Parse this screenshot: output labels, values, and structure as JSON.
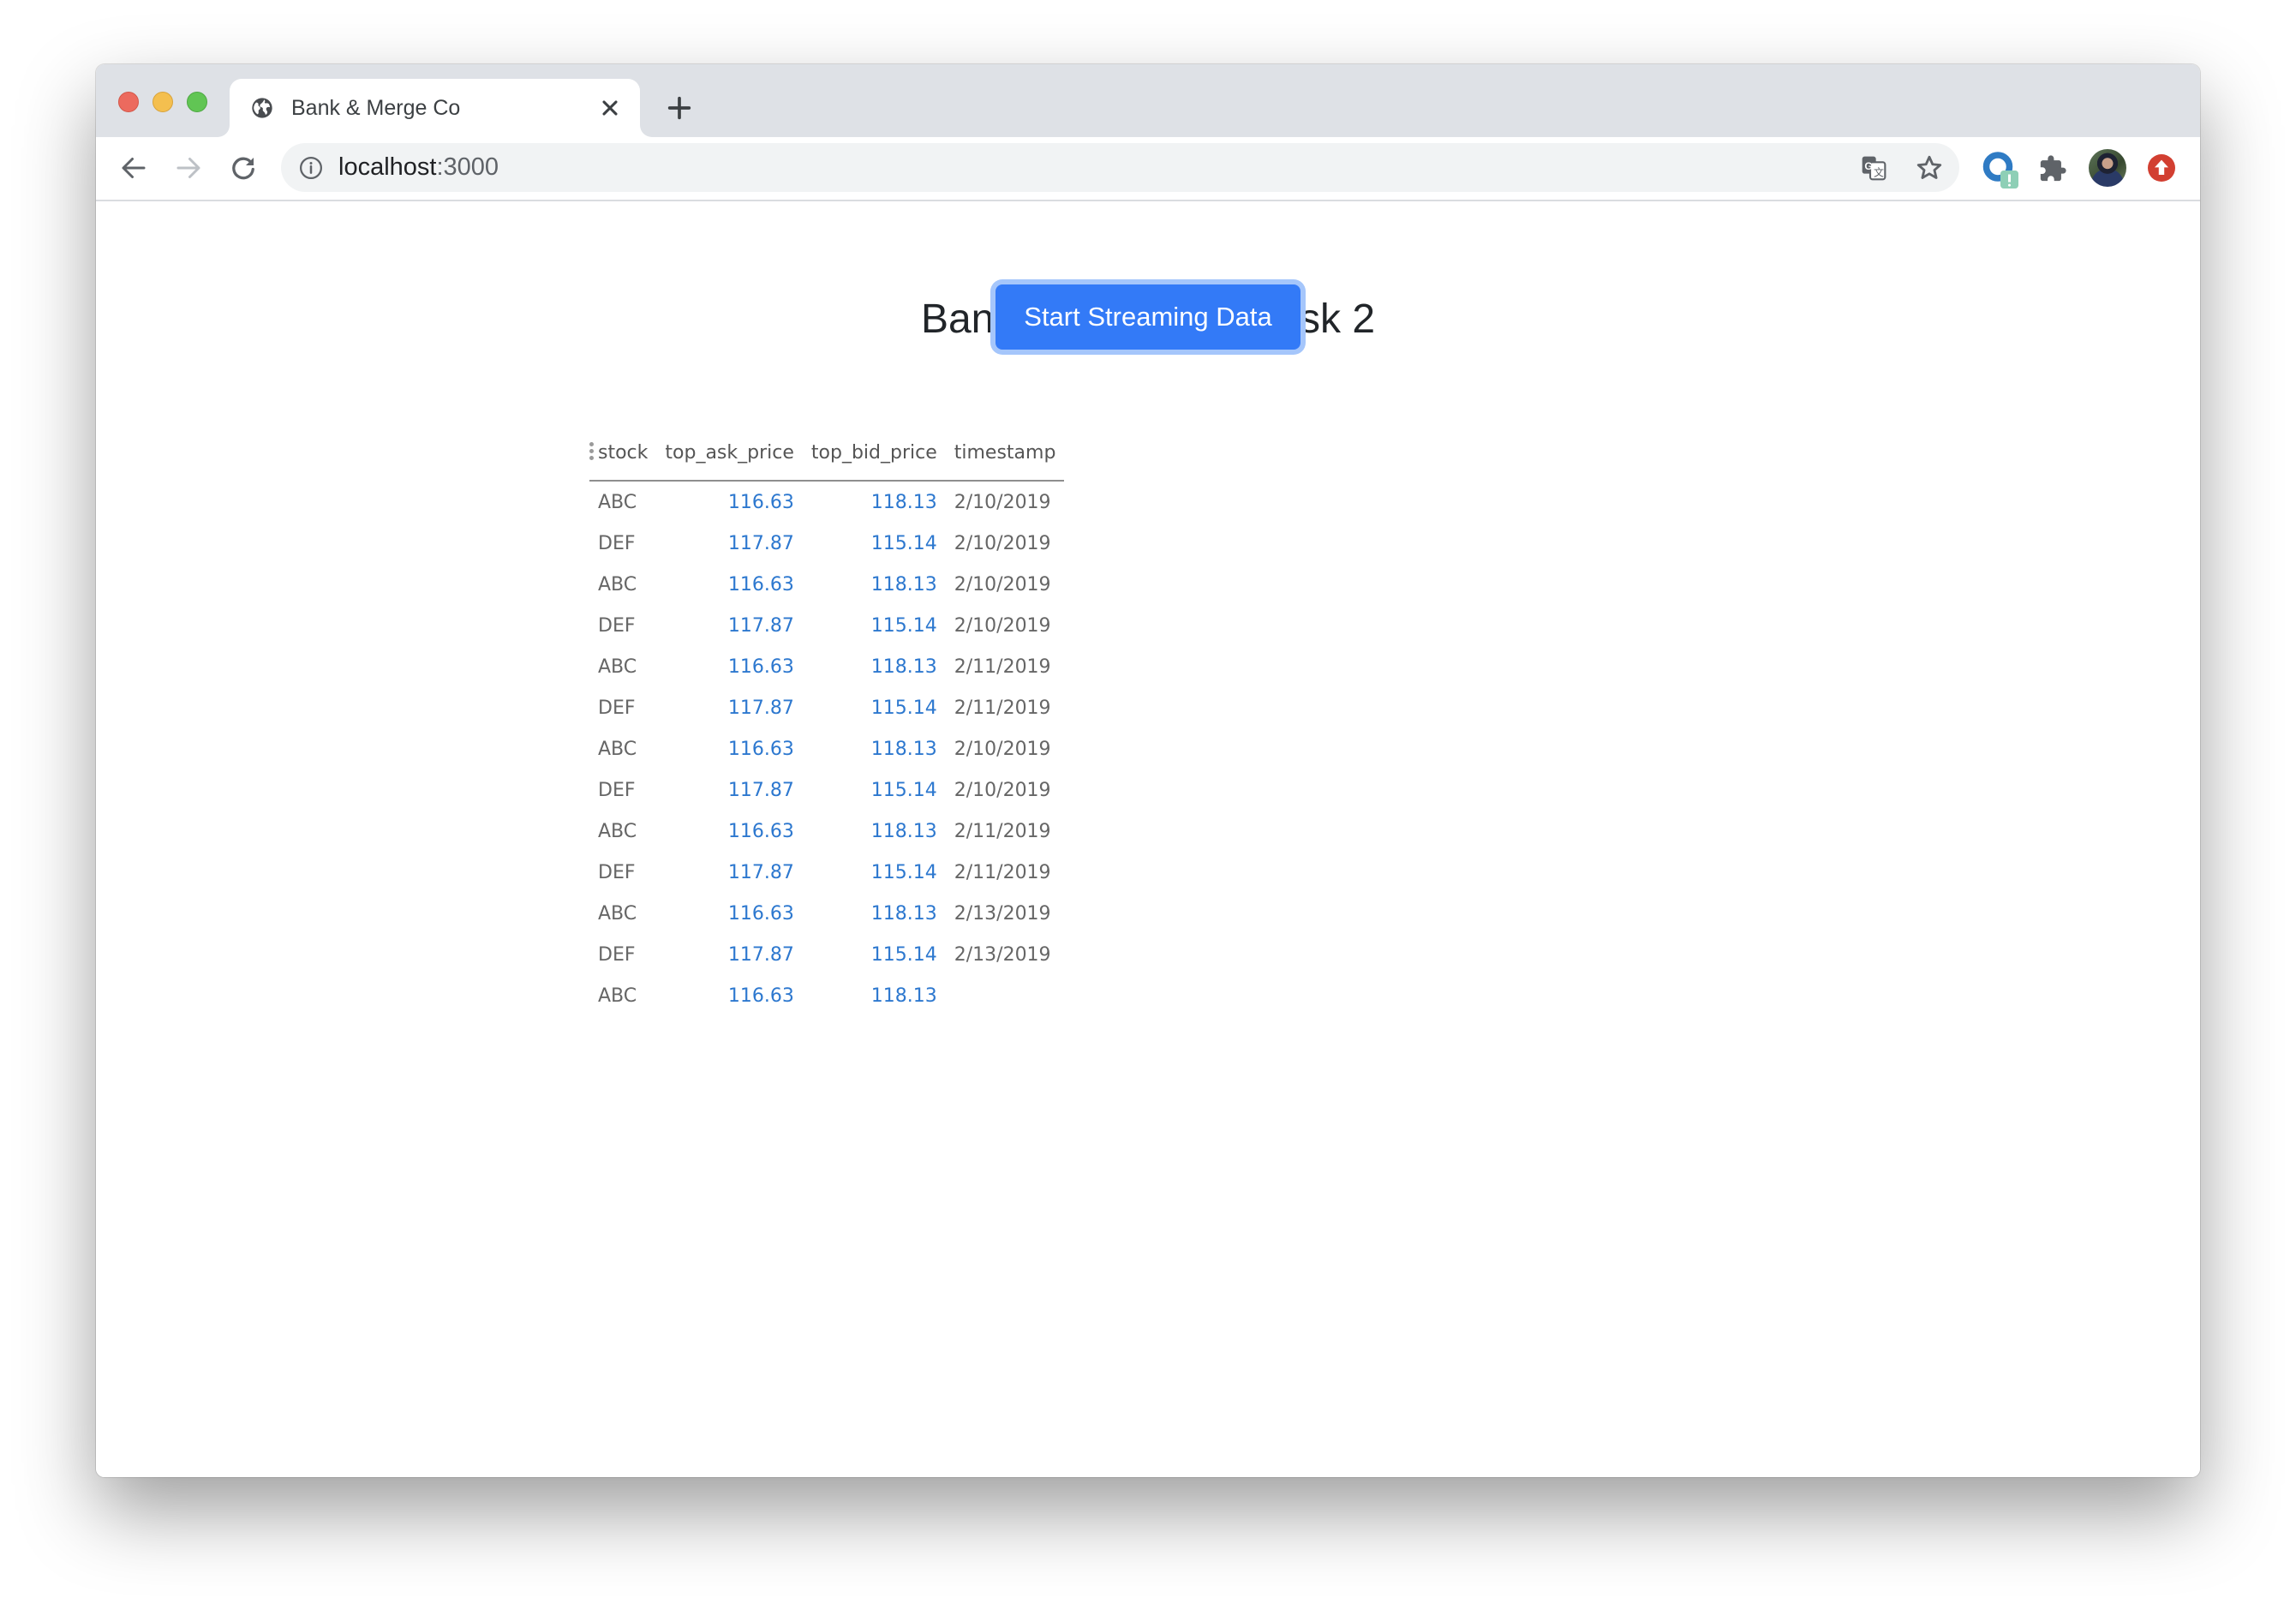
{
  "browser": {
    "tab": {
      "title": "Bank & Merge Co",
      "favicon": "globe-icon",
      "close_icon": "close-icon"
    },
    "new_tab_icon": "plus-icon",
    "nav": {
      "back_icon": "arrow-left-icon",
      "forward_icon": "arrow-right-icon",
      "reload_icon": "reload-icon"
    },
    "omnibox": {
      "security_icon": "info-icon",
      "host": "localhost",
      "port": ":3000",
      "translate_icon": "translate-icon",
      "bookmark_icon": "star-icon"
    },
    "extensions": [
      {
        "name": "extension-ring-icon",
        "badge": "!"
      },
      {
        "name": "puzzle-icon"
      }
    ],
    "profile_icon": "avatar",
    "update_icon": "upload-arrow-icon"
  },
  "page": {
    "title": "Bank & Merge Co Task 2",
    "stream_button": "Start Streaming Data",
    "colors": {
      "button": "#337af7",
      "button_ring": "#a5c6fb",
      "numeric": "#2d78cf"
    }
  },
  "table": {
    "columns": [
      "stock",
      "top_ask_price",
      "top_bid_price",
      "timestamp"
    ],
    "rows": [
      {
        "stock": "ABC",
        "top_ask_price": "116.63",
        "top_bid_price": "118.13",
        "timestamp": "2/10/2019"
      },
      {
        "stock": "DEF",
        "top_ask_price": "117.87",
        "top_bid_price": "115.14",
        "timestamp": "2/10/2019"
      },
      {
        "stock": "ABC",
        "top_ask_price": "116.63",
        "top_bid_price": "118.13",
        "timestamp": "2/10/2019"
      },
      {
        "stock": "DEF",
        "top_ask_price": "117.87",
        "top_bid_price": "115.14",
        "timestamp": "2/10/2019"
      },
      {
        "stock": "ABC",
        "top_ask_price": "116.63",
        "top_bid_price": "118.13",
        "timestamp": "2/11/2019"
      },
      {
        "stock": "DEF",
        "top_ask_price": "117.87",
        "top_bid_price": "115.14",
        "timestamp": "2/11/2019"
      },
      {
        "stock": "ABC",
        "top_ask_price": "116.63",
        "top_bid_price": "118.13",
        "timestamp": "2/10/2019"
      },
      {
        "stock": "DEF",
        "top_ask_price": "117.87",
        "top_bid_price": "115.14",
        "timestamp": "2/10/2019"
      },
      {
        "stock": "ABC",
        "top_ask_price": "116.63",
        "top_bid_price": "118.13",
        "timestamp": "2/11/2019"
      },
      {
        "stock": "DEF",
        "top_ask_price": "117.87",
        "top_bid_price": "115.14",
        "timestamp": "2/11/2019"
      },
      {
        "stock": "ABC",
        "top_ask_price": "116.63",
        "top_bid_price": "118.13",
        "timestamp": "2/13/2019"
      },
      {
        "stock": "DEF",
        "top_ask_price": "117.87",
        "top_bid_price": "115.14",
        "timestamp": "2/13/2019"
      },
      {
        "stock": "ABC",
        "top_ask_price": "116.63",
        "top_bid_price": "118.13",
        "timestamp": ""
      }
    ]
  }
}
